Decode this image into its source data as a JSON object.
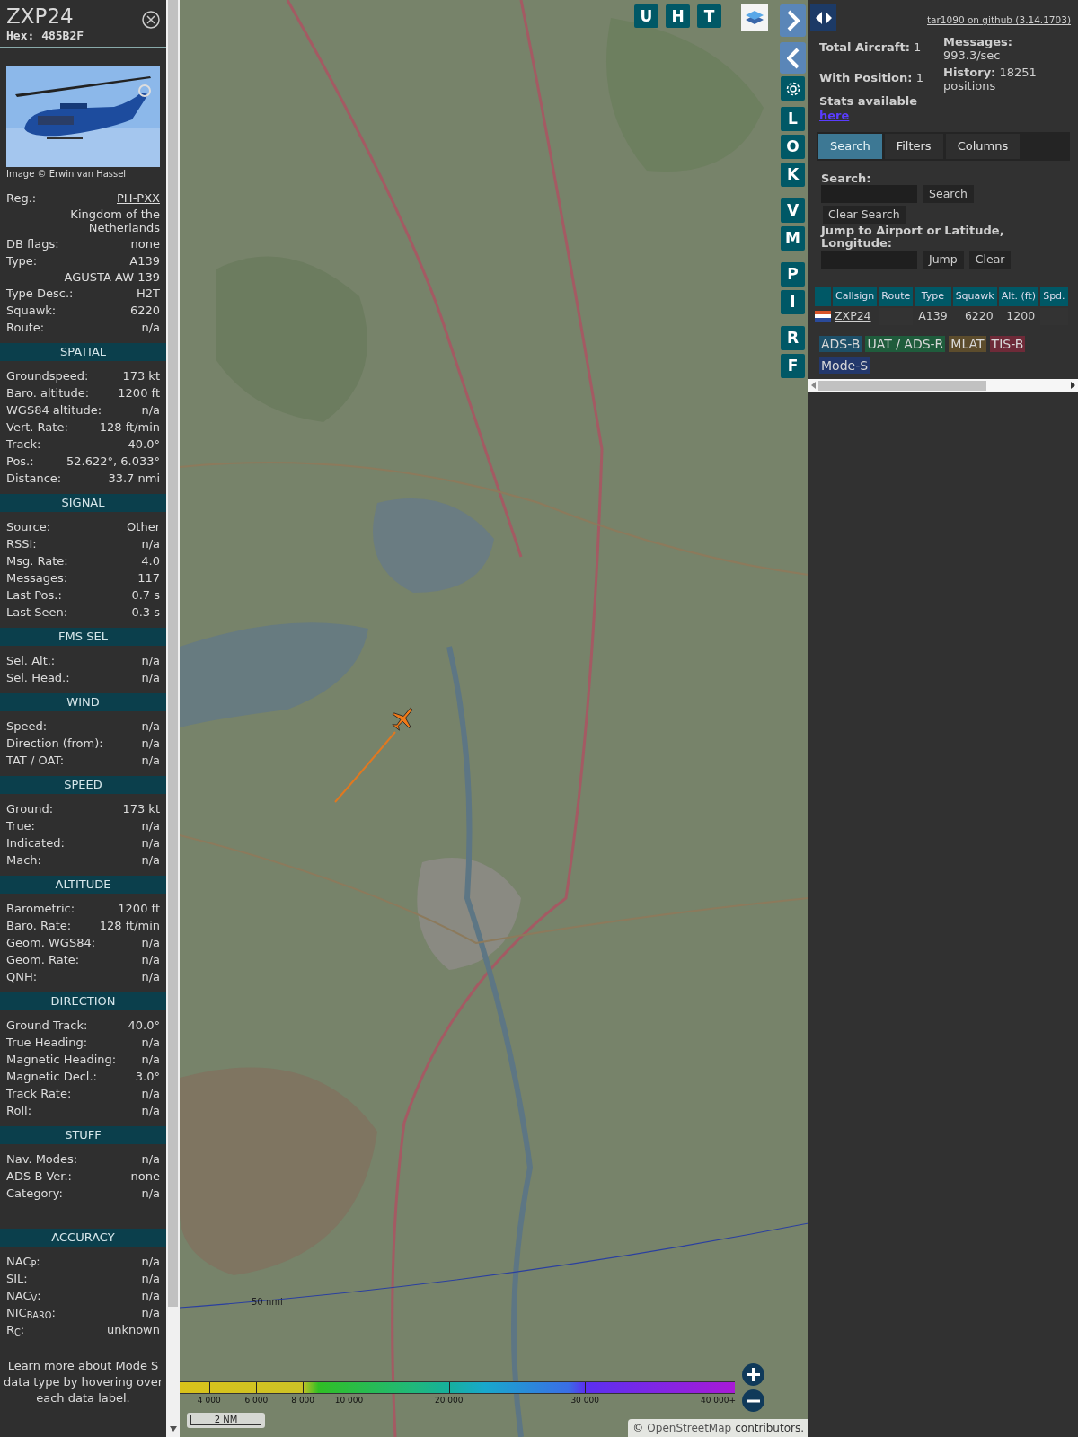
{
  "aircraft": {
    "callsign": "ZXP24",
    "hex": "Hex: 485B2F",
    "photo_credit": "Image © Erwin van Hassel",
    "details": [
      {
        "label": "Reg.:",
        "value": "PH-PXX",
        "kind": "link"
      },
      {
        "value": "Kingdom of the Netherlands",
        "kind": "text"
      },
      {
        "label": "DB flags:",
        "value": "none",
        "kind": "text"
      },
      {
        "label": "Type:",
        "value": "A139",
        "kind": "text"
      },
      {
        "value": "AGUSTA AW-139",
        "kind": "text"
      },
      {
        "label": "Type Desc.:",
        "value": "H2T",
        "kind": "text"
      },
      {
        "label": "Squawk:",
        "value": "6220",
        "kind": "text"
      },
      {
        "label": "Route:",
        "value": "n/a",
        "kind": "text"
      }
    ],
    "sections": [
      {
        "title": "SPATIAL",
        "rows": [
          {
            "label": "Groundspeed:",
            "value": "173 kt"
          },
          {
            "label": "Baro. altitude:",
            "value": "1200 ft"
          },
          {
            "label": "WGS84 altitude:",
            "value": "n/a"
          },
          {
            "label": "Vert. Rate:",
            "value": "128 ft/min"
          },
          {
            "label": "Track:",
            "value": "40.0°"
          },
          {
            "label": "Pos.:",
            "value": "52.622°, 6.033°"
          },
          {
            "label": "Distance:",
            "value": "33.7 nmi"
          }
        ]
      },
      {
        "title": "SIGNAL",
        "rows": [
          {
            "label": "Source:",
            "value": "Other"
          },
          {
            "label": "RSSI:",
            "value": "n/a"
          },
          {
            "label": "Msg. Rate:",
            "value": "4.0"
          },
          {
            "label": "Messages:",
            "value": "117"
          },
          {
            "label": "Last Pos.:",
            "value": "0.7 s"
          },
          {
            "label": "Last Seen:",
            "value": "0.3 s"
          }
        ]
      },
      {
        "title": "FMS SEL",
        "rows": [
          {
            "label": "Sel. Alt.:",
            "value": "n/a"
          },
          {
            "label": "Sel. Head.:",
            "value": "n/a"
          }
        ]
      },
      {
        "title": "WIND",
        "rows": [
          {
            "label": "Speed:",
            "value": "n/a"
          },
          {
            "label": "Direction (from):",
            "value": "n/a"
          },
          {
            "label": "TAT / OAT:",
            "value": "n/a"
          }
        ]
      },
      {
        "title": "SPEED",
        "rows": [
          {
            "label": "Ground:",
            "value": "173 kt"
          },
          {
            "label": "True:",
            "value": "n/a"
          },
          {
            "label": "Indicated:",
            "value": "n/a"
          },
          {
            "label": "Mach:",
            "value": "n/a"
          }
        ]
      },
      {
        "title": "ALTITUDE",
        "rows": [
          {
            "label": "Barometric:",
            "value": "1200 ft"
          },
          {
            "label": "Baro. Rate:",
            "value": "128 ft/min"
          },
          {
            "label": "Geom. WGS84:",
            "value": "n/a"
          },
          {
            "label": "Geom. Rate:",
            "value": "n/a"
          },
          {
            "label": "QNH:",
            "value": "n/a"
          }
        ]
      },
      {
        "title": "DIRECTION",
        "rows": [
          {
            "label": "Ground Track:",
            "value": "40.0°"
          },
          {
            "label": "True Heading:",
            "value": "n/a"
          },
          {
            "label": "Magnetic Heading:",
            "value": "n/a"
          },
          {
            "label": "Magnetic Decl.:",
            "value": "3.0°"
          },
          {
            "label": "Track Rate:",
            "value": "n/a"
          },
          {
            "label": "Roll:",
            "value": "n/a"
          }
        ]
      },
      {
        "title": "STUFF",
        "rows": [
          {
            "label": "Nav. Modes:",
            "value": "n/a"
          },
          {
            "label": "ADS-B Ver.:",
            "value": "none"
          },
          {
            "label": "Category:",
            "value": "n/a"
          }
        ]
      },
      {
        "title": "ACCURACY",
        "rows": [
          {
            "label": "NAC$_{P}$:",
            "value": "n/a"
          },
          {
            "label": "SIL:",
            "value": "n/a"
          },
          {
            "label": "NAC$_{V}$:",
            "value": "n/a"
          },
          {
            "label": "NIC$_{BARO}$:",
            "value": "n/a"
          },
          {
            "label": "R$_{C}$:",
            "value": "unknown"
          }
        ]
      }
    ],
    "footer_note": "Learn more about Mode S data type by hovering over each data label."
  },
  "map": {
    "top_buttons": [
      "U",
      "H",
      "T"
    ],
    "side_groups": [
      [
        "L",
        "O",
        "K"
      ],
      [
        "V",
        "M"
      ],
      [
        "P",
        "I"
      ],
      [
        "R",
        "F"
      ]
    ],
    "range_ring_label": "50 nmi",
    "altitude_legend": [
      "4 000",
      "6 000",
      "8 000",
      "10 000",
      "20 000",
      "30 000",
      "40 000+"
    ],
    "scale_bar": "2 NM",
    "attribution": {
      "prefix": "©",
      "link": "OpenStreetMap",
      "suffix": "contributors."
    }
  },
  "sidebar": {
    "github_link": "tar1090 on github (3.14.1703)",
    "stats_left": [
      "**Total Aircraft:** 1",
      "**With Position:** 1"
    ],
    "stats_right": [
      "**Messages:** 993.3/sec",
      "**History:** 18251 positions"
    ],
    "stats_label": "Stats available",
    "stats_link": "here",
    "tabs": [
      {
        "label": "Search",
        "selected": true
      },
      {
        "label": "Filters",
        "selected": false
      },
      {
        "label": "Columns",
        "selected": false
      }
    ],
    "search": {
      "label": "Search:",
      "button": "Search",
      "clear_button": "Clear Search",
      "jump_label": "Jump to Airport or Latitude, Longitude:",
      "jump_button": "Jump",
      "jump_clear_button": "Clear"
    },
    "table": {
      "columns": [
        {
          "kind": "blank"
        },
        {
          "kind": "label",
          "label": "Callsign"
        },
        {
          "kind": "label",
          "label": "Route"
        },
        {
          "kind": "label",
          "label": "Type"
        },
        {
          "kind": "label",
          "label": "Squawk"
        },
        {
          "kind": "label",
          "label": "Alt. (ft)"
        },
        {
          "kind": "label",
          "label": "Spd."
        }
      ],
      "rows": [
        {
          "cells": [
            {
              "kind": "flag"
            },
            {
              "kind": "link",
              "text": "ZXP24"
            },
            {
              "kind": "blank"
            },
            {
              "kind": "text",
              "text": "A139"
            },
            {
              "kind": "text",
              "text": "6220"
            },
            {
              "kind": "text",
              "text": "1200"
            },
            {
              "kind": "blank"
            }
          ]
        }
      ]
    },
    "legend": [
      {
        "label": "ADS-B",
        "color": "#1d4f68"
      },
      {
        "label": "UAT / ADS-R",
        "color": "#1f5c3c"
      },
      {
        "label": "MLAT",
        "color": "#5c4c2c"
      },
      {
        "label": "TIS-B",
        "color": "#6e2a38"
      },
      {
        "label": "Mode-S",
        "color": "#23386c"
      }
    ]
  }
}
